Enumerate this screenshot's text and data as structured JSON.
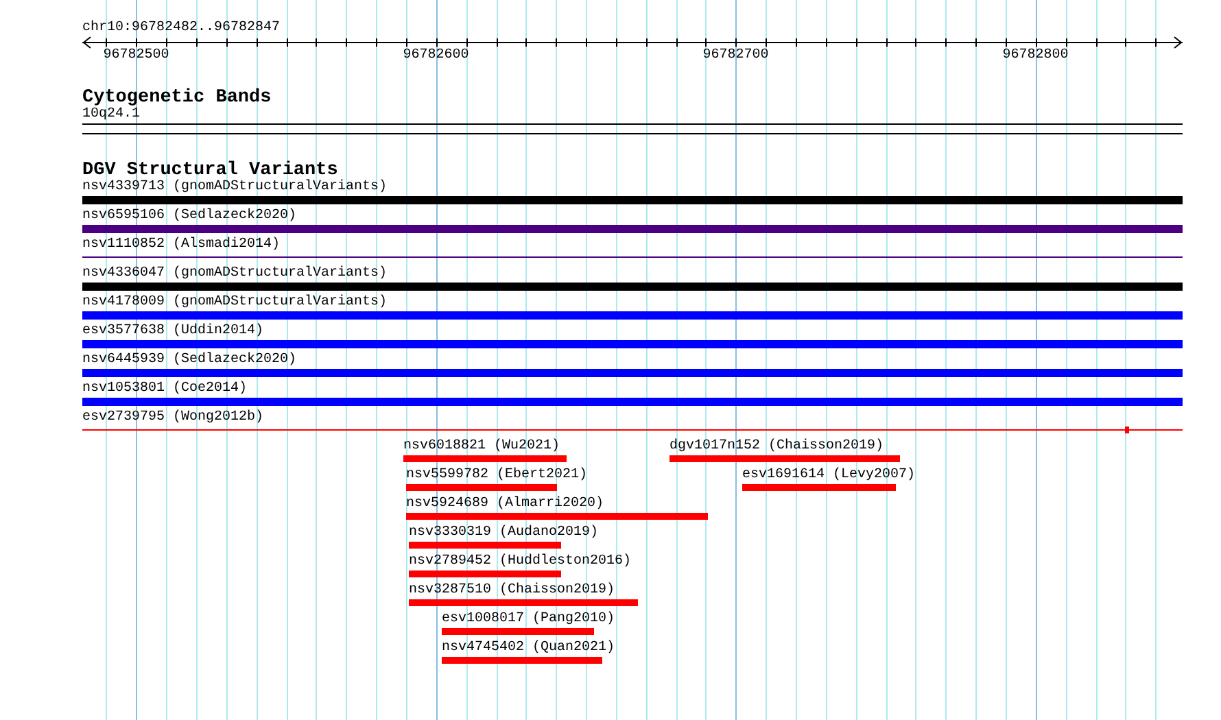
{
  "ruler": {
    "location": "chr10:96782482..96782847",
    "ticks": [
      "96782500",
      "96782600",
      "96782700",
      "96782800"
    ]
  },
  "tracks": [
    {
      "title": "Cytogenetic Bands",
      "kind": "bands",
      "features": [
        {
          "label": "10q24.1"
        }
      ]
    },
    {
      "title": "DGV Structural Variants",
      "kind": "variants",
      "features": [
        {
          "label": "nsv4339713 (gnomADStructuralVariants)",
          "color": "#000000",
          "kind": "thick"
        },
        {
          "label": "nsv6595106 (Sedlazeck2020)",
          "color": "#4b0082",
          "kind": "thick"
        },
        {
          "label": "nsv1110852 (Alsmadi2014)",
          "color": "#4b0082",
          "kind": "thin"
        },
        {
          "label": "nsv4336047 (gnomADStructuralVariants)",
          "color": "#000000",
          "kind": "thick"
        },
        {
          "label": "nsv4178009 (gnomADStructuralVariants)",
          "color": "#0000ff",
          "kind": "thick"
        },
        {
          "label": "esv3577638 (Uddin2014)",
          "color": "#0000ff",
          "kind": "thick"
        },
        {
          "label": "nsv6445939 (Sedlazeck2020)",
          "color": "#0000ff",
          "kind": "thick"
        },
        {
          "label": "nsv1053801 (Coe2014)",
          "color": "#0000ff",
          "kind": "thick"
        },
        {
          "label": "esv2739795 (Wong2012b)",
          "color": "#ff0000",
          "kind": "thin"
        },
        {
          "label": "nsv6018821 (Wu2021)",
          "color": "#ff0000",
          "kind": "thick"
        },
        {
          "label": "dgv1017n152 (Chaisson2019)",
          "color": "#ff0000",
          "kind": "thick"
        },
        {
          "label": "nsv5599782 (Ebert2021)",
          "color": "#ff0000",
          "kind": "thick"
        },
        {
          "label": "esv1691614 (Levy2007)",
          "color": "#ff0000",
          "kind": "thick"
        },
        {
          "label": "nsv5924689 (Almarri2020)",
          "color": "#ff0000",
          "kind": "thick"
        },
        {
          "label": "nsv3330319 (Audano2019)",
          "color": "#ff0000",
          "kind": "thick"
        },
        {
          "label": "nsv2789452 (Huddleston2016)",
          "color": "#ff0000",
          "kind": "thick"
        },
        {
          "label": "nsv3287510 (Chaisson2019)",
          "color": "#ff0000",
          "kind": "thick"
        },
        {
          "label": "esv1008017 (Pang2010)",
          "color": "#ff0000",
          "kind": "thick"
        },
        {
          "label": "nsv4745402 (Quan2021)",
          "color": "#ff0000",
          "kind": "thick"
        }
      ]
    }
  ]
}
